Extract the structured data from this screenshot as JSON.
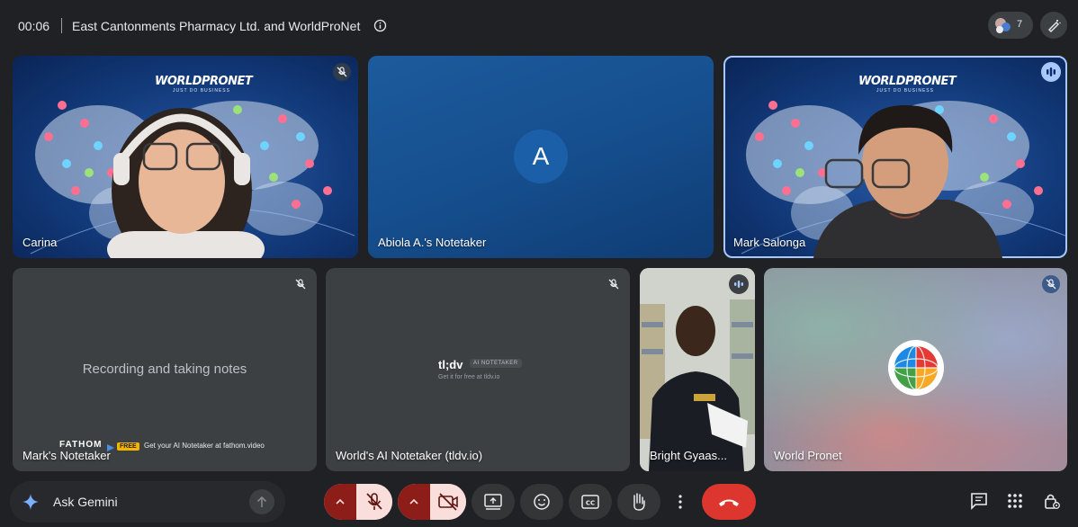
{
  "meeting": {
    "elapsed": "00:06",
    "title": "East Cantonments Pharmacy Ltd. and WorldProNet",
    "participant_count": "7"
  },
  "tiles": {
    "carina": {
      "name": "Carina",
      "muted": true
    },
    "abiola": {
      "name": "Abiola A.'s Notetaker",
      "initial": "A"
    },
    "mark": {
      "name": "Mark Salonga",
      "speaking": true
    },
    "marks_notetaker": {
      "name": "Mark's Notetaker",
      "status": "Recording and taking notes",
      "banner_brand": "FATHOM",
      "banner_free": "FREE",
      "banner_text": "Get your AI Notetaker at fathom.video"
    },
    "tldv": {
      "name": "World's AI Notetaker (tldv.io)",
      "logo": "tl;dv",
      "badge": "AI NOTETAKER",
      "tagline": "Get it for free at tldv.io"
    },
    "bright": {
      "name": "Bright Gyaas..."
    },
    "world_pronet": {
      "name": "World Pronet"
    }
  },
  "background_logo": {
    "brand": "WORLDPRONET",
    "tagline": "JUST DO BUSINESS"
  },
  "bottom_bar": {
    "gemini_placeholder": "Ask Gemini",
    "mic_state": "muted",
    "camera_state": "off"
  },
  "colors": {
    "background": "#202124",
    "tile_dark": "#3c4043",
    "control_off": "#f9dedc",
    "control_off_caret": "#8c1d18",
    "hangup": "#dc362e",
    "speaking": "#a8c7fa"
  },
  "icons": [
    "info-icon",
    "people-icon",
    "pen-icon",
    "mic-off-icon",
    "audio-wave-icon",
    "gemini-star-icon",
    "send-arrow-icon",
    "chevron-up-icon",
    "camera-off-icon",
    "present-screen-icon",
    "emoji-icon",
    "captions-icon",
    "raise-hand-icon",
    "more-vert-icon",
    "call-end-icon",
    "chat-icon",
    "activities-icon",
    "host-controls-icon"
  ]
}
